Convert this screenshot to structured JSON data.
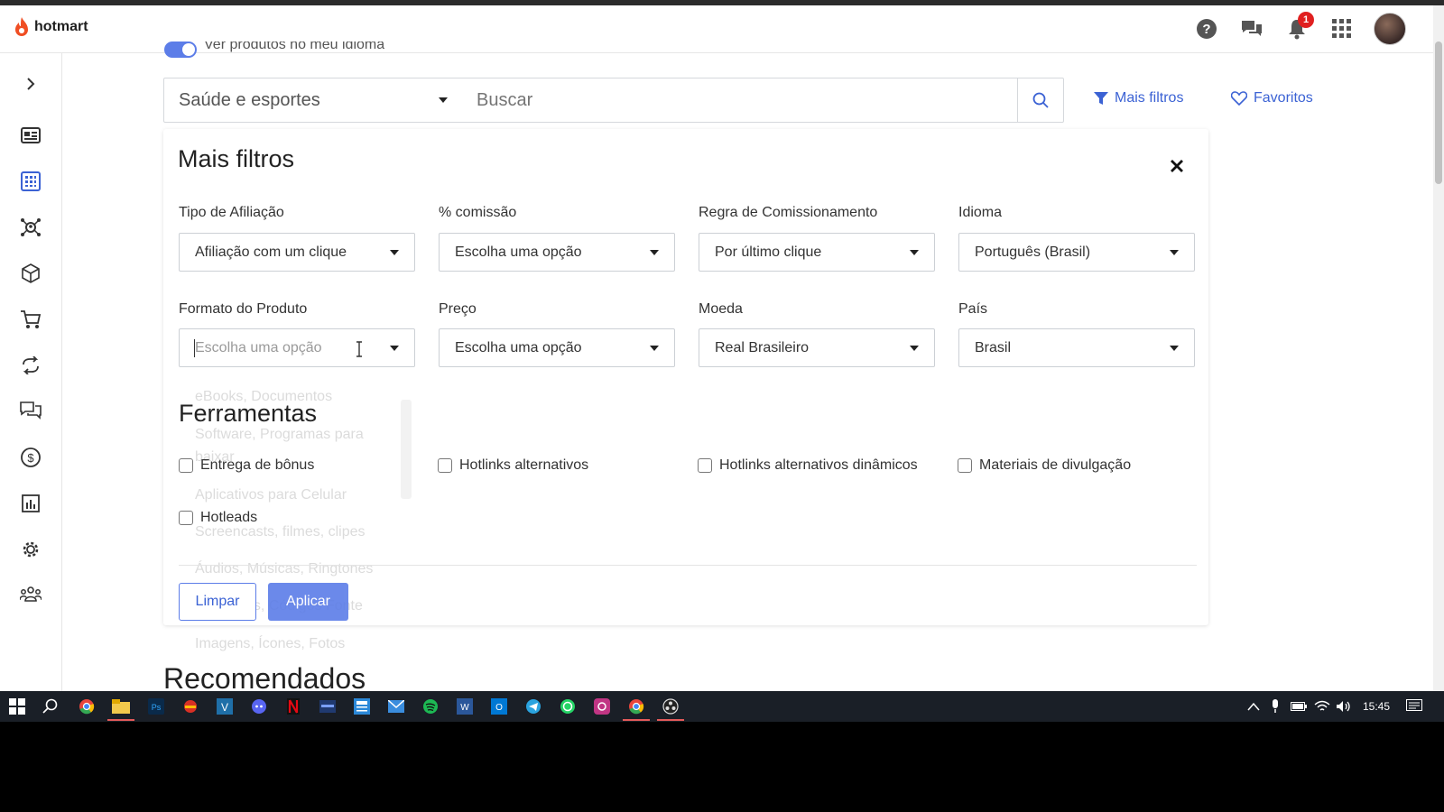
{
  "header": {
    "logo_text": "hotmart",
    "notification_count": "1"
  },
  "filters_bar": {
    "category_value": "Saúde e esportes",
    "search_placeholder": "Buscar",
    "more_filters_label": "Mais filtros",
    "favorites_label": "Favoritos",
    "toggle_label": "Ver produtos no meu idioma"
  },
  "panel": {
    "title": "Mais filtros",
    "fields": [
      {
        "label": "Tipo de Afiliação",
        "value": "Afiliação com um clique"
      },
      {
        "label": "% comissão",
        "value": "Escolha uma opção"
      },
      {
        "label": "Regra de Comissionamento",
        "value": "Por último clique"
      },
      {
        "label": "Idioma",
        "value": "Português (Brasil)"
      },
      {
        "label": "Formato do Produto",
        "value": "Escolha uma opção"
      },
      {
        "label": "Preço",
        "value": "Escolha uma opção"
      },
      {
        "label": "Moeda",
        "value": "Real Brasileiro"
      },
      {
        "label": "País",
        "value": "Brasil"
      }
    ],
    "format_options": [
      "eBooks, Documentos",
      "Software, Programas para baixar",
      "Aplicativos para Celular",
      "Screencasts, filmes, clipes",
      "Áudios, Músicas, Ringtones",
      "Templates, Códigos Fonte",
      "Imagens, Ícones, Fotos"
    ],
    "tools_title": "Ferramentas",
    "tools": [
      "Entrega de bônus",
      "Hotlinks alternativos",
      "Hotlinks alternativos dinâmicos",
      "Materiais de divulgação",
      "Hotleads"
    ],
    "clear_label": "Limpar",
    "apply_label": "Aplicar"
  },
  "recommended_title": "Recomendados",
  "taskbar": {
    "time": "15:45"
  },
  "colors": {
    "brand": "#f04e23",
    "accent": "#3b62d4"
  }
}
